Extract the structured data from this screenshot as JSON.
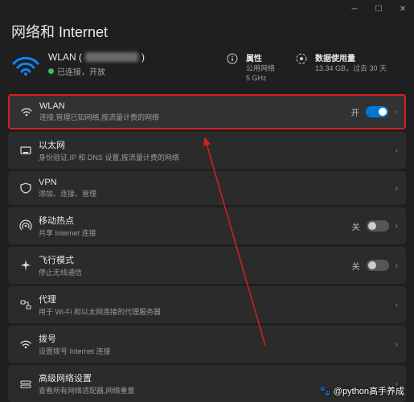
{
  "page_title": "网络和 Internet",
  "hero": {
    "ssid_prefix": "WLAN (",
    "ssid_suffix": ")",
    "status": "已连接，开放",
    "props": {
      "label": "属性",
      "line1": "公用网络",
      "line2": "5 GHz"
    },
    "usage": {
      "label": "数据使用量",
      "line1": "13.34 GB，过去 30 天"
    }
  },
  "items": [
    {
      "title": "WLAN",
      "sub": "连接,管理已知网络,按流量计费的网络",
      "right_label": "开",
      "switch": "on",
      "icon": "wifi"
    },
    {
      "title": "以太网",
      "sub": "身份验证,IP 和 DNS 设置,按流量计费的网络",
      "icon": "ethernet"
    },
    {
      "title": "VPN",
      "sub": "添加、连接、管理",
      "icon": "vpn"
    },
    {
      "title": "移动热点",
      "sub": "共享 Internet 连接",
      "right_label": "关",
      "switch": "off",
      "icon": "hotspot"
    },
    {
      "title": "飞行模式",
      "sub": "停止无线通信",
      "right_label": "关",
      "switch": "off",
      "icon": "airplane"
    },
    {
      "title": "代理",
      "sub": "用于 Wi-Fi 和以太网连接的代理服务器",
      "icon": "proxy"
    },
    {
      "title": "拨号",
      "sub": "设置拨号 Internet 连接",
      "icon": "dialup"
    },
    {
      "title": "高级网络设置",
      "sub": "查看所有网络适配器,网络重置",
      "icon": "advanced"
    }
  ],
  "watermark": "@python高手养成"
}
